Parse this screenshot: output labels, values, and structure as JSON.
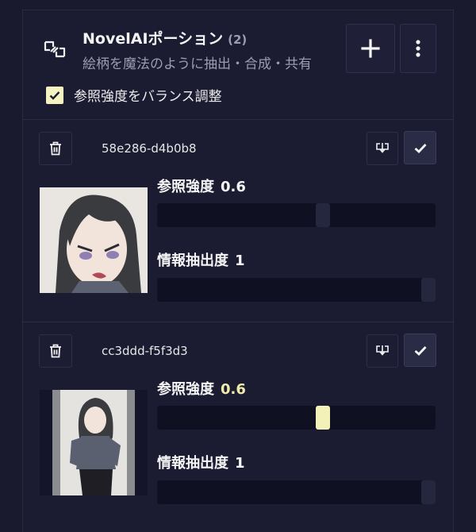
{
  "header": {
    "title": "NovelAIポーション",
    "count": "(2)",
    "subtitle": "絵柄を魔法のように抽出・合成・共有"
  },
  "options": {
    "balance_label": "参照強度をバランス調整",
    "balance_checked": true
  },
  "vibes": [
    {
      "hash": "58e286-d4b0b8",
      "strength_label": "参照強度",
      "strength_value": "0.6",
      "strength": 0.6,
      "info_label": "情報抽出度",
      "info_value": "1",
      "info": 1.0
    },
    {
      "hash": "cc3ddd-f5f3d3",
      "strength_label": "参照強度",
      "strength_value": "0.6",
      "strength": 0.6,
      "info_label": "情報抽出度",
      "info_value": "1",
      "info": 1.0
    }
  ],
  "icons": {
    "header": "vibe-transfer-icon",
    "add": "plus-icon",
    "more": "more-vertical-icon",
    "delete": "trash-icon",
    "download": "download-icon",
    "confirm": "check-icon"
  },
  "colors": {
    "background": "#191a2e",
    "accent": "#f3f0b8",
    "muted_text": "#9a9cb0"
  }
}
